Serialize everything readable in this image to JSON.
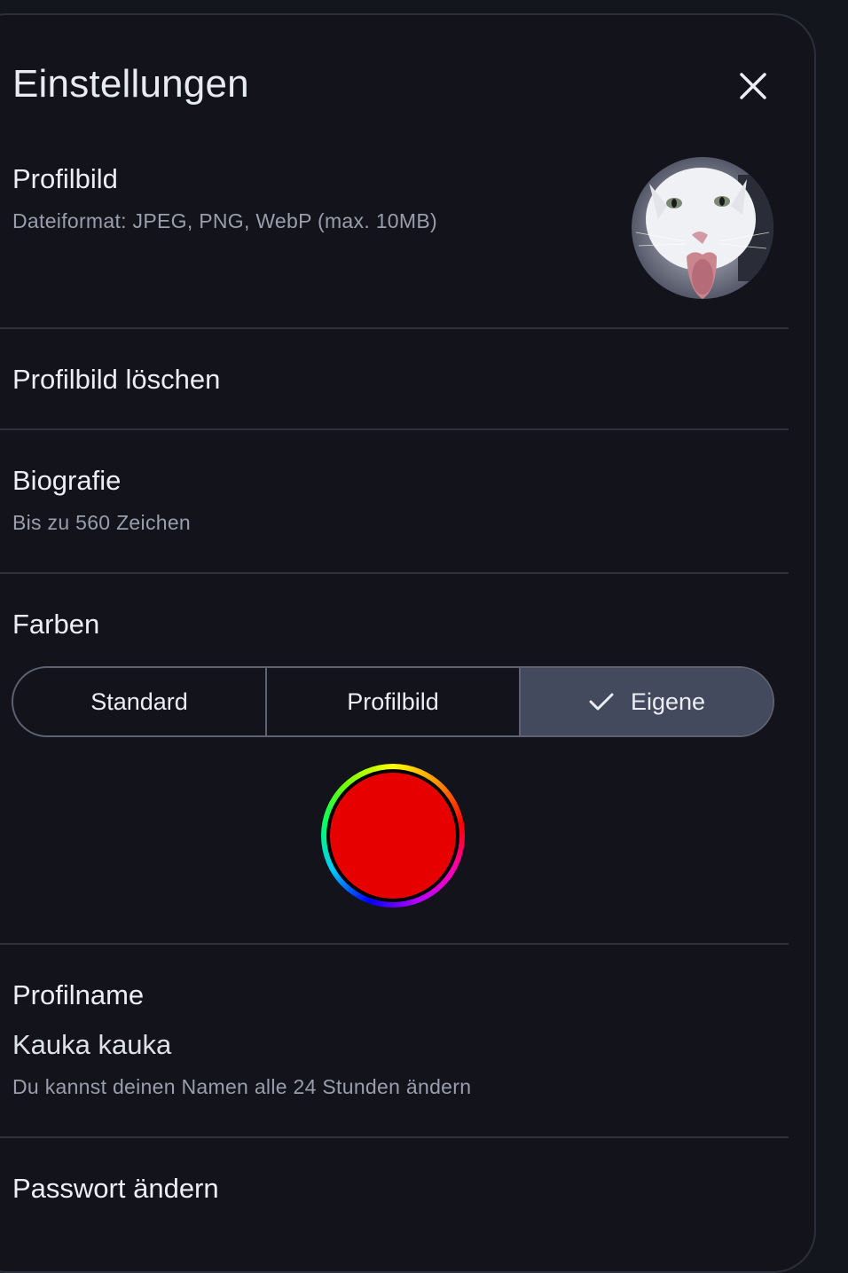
{
  "header": {
    "title": "Einstellungen",
    "close_icon": "close-icon"
  },
  "profile_picture": {
    "label": "Profilbild",
    "hint": "Dateiformat: JPEG, PNG, WebP (max. 10MB)"
  },
  "delete_picture": {
    "label": "Profilbild löschen"
  },
  "biography": {
    "label": "Biografie",
    "hint": "Bis zu 560 Zeichen"
  },
  "colors": {
    "label": "Farben",
    "options": [
      {
        "label": "Standard",
        "selected": false
      },
      {
        "label": "Profilbild",
        "selected": false
      },
      {
        "label": "Eigene",
        "selected": true
      }
    ],
    "custom_color": "#e60000"
  },
  "profile_name": {
    "label": "Profilname",
    "value": "Kauka kauka",
    "hint": "Du kannst deinen Namen alle 24 Stunden ändern"
  },
  "password": {
    "label": "Passwort ändern"
  }
}
